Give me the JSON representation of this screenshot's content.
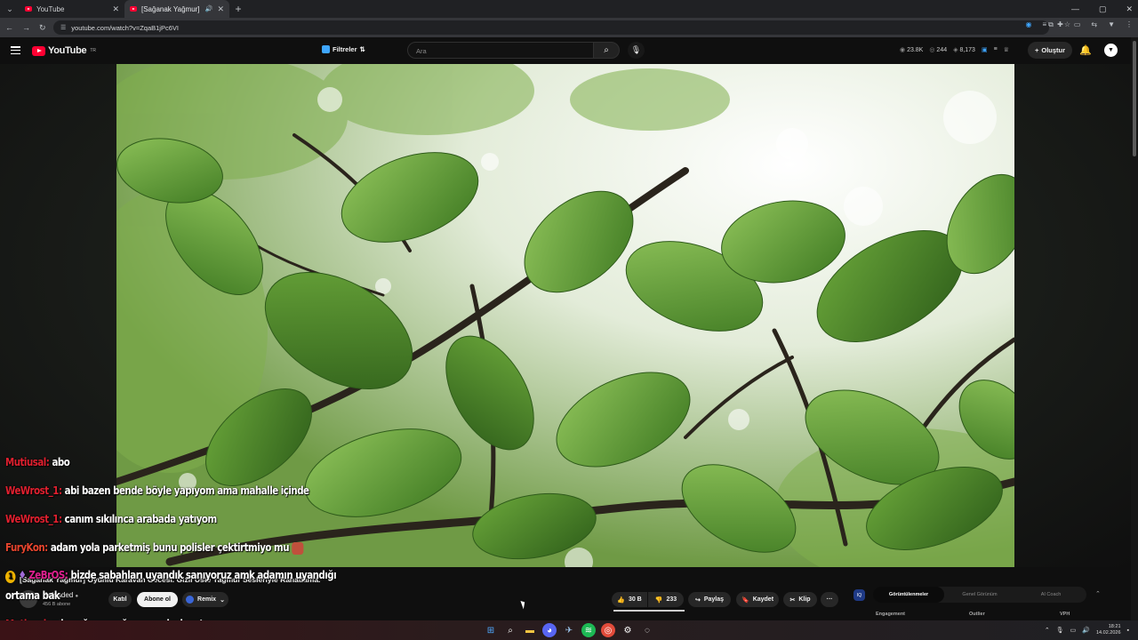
{
  "browser": {
    "tabs": [
      {
        "title": "YouTube",
        "active": false
      },
      {
        "title": "[Sağanak Yağmur] Oyunlu Ka",
        "active": true
      }
    ],
    "new_tab": "+",
    "url": "youtube.com/watch?v=ZqaB1jPc6VI",
    "window_controls": {
      "minimize": "—",
      "maximize": "▢",
      "close": "✕"
    }
  },
  "youtube": {
    "logo_text": "YouTube",
    "logo_region": "TR",
    "filters_label": "Filtreler",
    "search_placeholder": "Ara",
    "stats": {
      "views": "23.8K",
      "viewers": "244",
      "likes": "8,173"
    },
    "create_label": "Oluştur"
  },
  "chat": [
    {
      "user": "Mutiusal:",
      "message": "abo"
    },
    {
      "user": "WeWrost_1:",
      "message": "abi bazen bende böyle yapıyom ama mahalle içinde"
    },
    {
      "user": "WeWrost_1:",
      "message": "canım sıkılınca arabada yatıyom"
    },
    {
      "user": "FuryKon:",
      "message": "adam yola parketmiş bunu polisler çektirtmiyo mu"
    },
    {
      "user": "ZeBrOS:",
      "message": "bizde sabahları uyandık sanıyoruz amk adamın uyandığı"
    },
    {
      "user": "ortama bak",
      "message": ""
    },
    {
      "user": "Mutiusal:",
      "message": "o iş yağmur yağıncı yapılcak usta"
    }
  ],
  "video": {
    "title": "[Sağanak Yağmur] Oyunlu Karavan Gecesi. Gizli Üste Yağmur Sesleriyle Rahatlama.",
    "channel": "Reloaded",
    "subscribers": "456 B abone",
    "join_label": "Katıl",
    "subscribe_label": "Abone ol",
    "remix_label": "Remix",
    "likes": "30 B",
    "dislikes": "233",
    "share_label": "Paylaş",
    "save_label": "Kaydet",
    "clip_label": "Klip",
    "more_label": "···"
  },
  "analytics_panel": {
    "badge": "IQ",
    "tabs": [
      "Görüntülenmeler",
      "Genel Görünüm",
      "AI Coach"
    ],
    "active_tab": 0,
    "sub_tabs": [
      "Engagement",
      "Outlier",
      "VPH"
    ]
  },
  "taskbar": {
    "time": "18:21",
    "date": "14.02.2026"
  }
}
